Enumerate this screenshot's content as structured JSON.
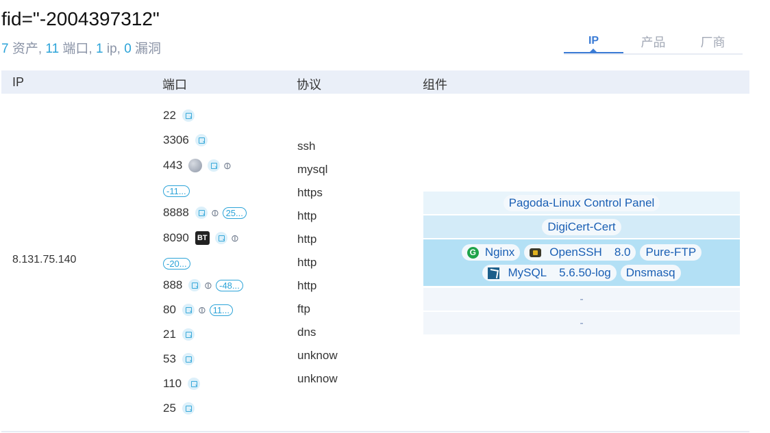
{
  "header": {
    "title": "fid=\"-2004397312\"",
    "stats": {
      "assets_count": "7",
      "assets_label": " 资产, ",
      "ports_count": "11",
      "ports_label": " 端口, ",
      "ip_count": "1",
      "ip_label": " ip, ",
      "vulns_count": "0",
      "vulns_label": " 漏洞"
    }
  },
  "tabs": [
    {
      "label": "IP",
      "active": true
    },
    {
      "label": "产品",
      "active": false
    },
    {
      "label": "厂商",
      "active": false
    }
  ],
  "table": {
    "headers": {
      "ip": "IP",
      "port": "端口",
      "protocol": "协议",
      "component": "组件"
    },
    "ip": "8.131.75.140",
    "ports": [
      {
        "port": "22",
        "icons": [
          "detail-icon"
        ]
      },
      {
        "port": "3306",
        "icons": [
          "detail-icon"
        ]
      },
      {
        "port": "443",
        "icons": [
          "globe-icon",
          "detail-icon",
          "link-icon"
        ]
      },
      {
        "port": "",
        "badge": "-11..."
      },
      {
        "port": "8888",
        "icons": [
          "detail-icon",
          "link-icon"
        ],
        "badge": "25..."
      },
      {
        "port": "8090",
        "icons": [
          "bt-icon",
          "detail-icon",
          "link-icon"
        ]
      },
      {
        "port": "",
        "badge": "-20..."
      },
      {
        "port": "888",
        "icons": [
          "detail-icon",
          "link-icon"
        ],
        "badge": "-48..."
      },
      {
        "port": "80",
        "icons": [
          "detail-icon",
          "link-icon"
        ],
        "badge": "11..."
      },
      {
        "port": "21",
        "icons": [
          "detail-icon"
        ]
      },
      {
        "port": "53",
        "icons": [
          "detail-icon"
        ]
      },
      {
        "port": "110",
        "icons": [
          "detail-icon"
        ]
      },
      {
        "port": "25",
        "icons": [
          "detail-icon"
        ]
      }
    ],
    "bt_label": "BT",
    "protocols": [
      "ssh",
      "mysql",
      "https",
      "http",
      "http",
      "http",
      "http",
      "ftp",
      "dns",
      "unknow",
      "unknow"
    ],
    "components": {
      "row1": {
        "name": "Pagoda-Linux Control Panel",
        "color": "#e8f4fb"
      },
      "row2": {
        "name": "DigiCert-Cert",
        "color": "#d3ebf8"
      },
      "row3": {
        "color": "#b3e0f5",
        "line1": [
          {
            "name": "Nginx",
            "icon": "nginx-icon"
          },
          {
            "name": "OpenSSH",
            "version": "8.0",
            "icon": "openssh-icon"
          },
          {
            "name": "Pure-FTP"
          }
        ],
        "line2": [
          {
            "name": "MySQL",
            "version": "5.6.50-log",
            "icon": "mysql-icon"
          },
          {
            "name": "Dnsmasq"
          }
        ]
      },
      "row4": {
        "name": "-",
        "color": "#f2f6fb"
      },
      "row5": {
        "name": "-",
        "color": "#f2f6fb"
      }
    }
  }
}
